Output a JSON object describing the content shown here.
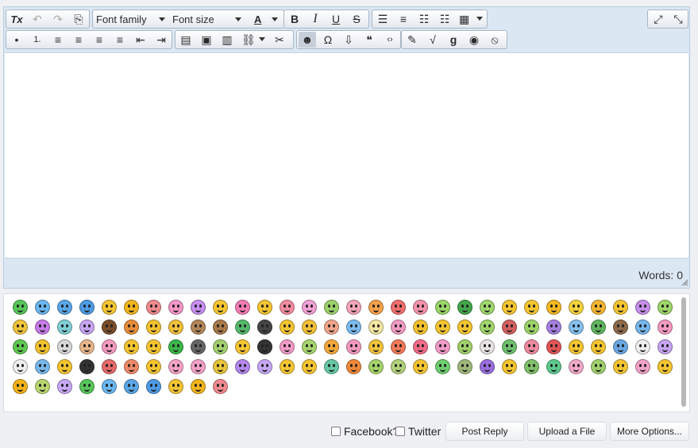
{
  "toolbar": {
    "row1": [
      {
        "name": "clear-formatting-icon",
        "glyph": "Tx",
        "disabled": false
      },
      {
        "name": "undo-icon",
        "glyph": "↶",
        "disabled": true
      },
      {
        "name": "redo-icon",
        "glyph": "↷",
        "disabled": true
      },
      {
        "name": "paste-icon",
        "glyph": "⎘",
        "disabled": false
      }
    ],
    "font_family": "Font family",
    "font_size": "Font size",
    "text_color_label": "A",
    "format": [
      {
        "name": "bold-icon",
        "glyph": "B"
      },
      {
        "name": "italic-icon",
        "glyph": "I"
      },
      {
        "name": "underline-icon",
        "glyph": "U"
      },
      {
        "name": "strikethrough-icon",
        "glyph": "S"
      }
    ],
    "insert": [
      {
        "name": "template-icon",
        "glyph": "☰"
      },
      {
        "name": "paragraph-block-icon",
        "glyph": "≡"
      },
      {
        "name": "columns-icon",
        "glyph": "☷"
      },
      {
        "name": "page-icon",
        "glyph": "☷"
      },
      {
        "name": "table-icon",
        "glyph": "▦"
      }
    ],
    "right": [
      {
        "name": "restore-icon",
        "glyph": "⤢"
      },
      {
        "name": "fullscreen-icon",
        "glyph": "⤡"
      }
    ],
    "row2_lists": [
      {
        "name": "bullet-list-icon",
        "glyph": "•"
      },
      {
        "name": "numbered-list-icon",
        "glyph": "1."
      },
      {
        "name": "align-left-icon",
        "glyph": "≡"
      },
      {
        "name": "align-center-icon",
        "glyph": "≡"
      },
      {
        "name": "align-right-icon",
        "glyph": "≡"
      },
      {
        "name": "justify-icon",
        "glyph": "≡"
      },
      {
        "name": "outdent-icon",
        "glyph": "⇤"
      },
      {
        "name": "indent-icon",
        "glyph": "⇥"
      }
    ],
    "row2_media": [
      {
        "name": "gallery-icon",
        "glyph": "▤"
      },
      {
        "name": "image-icon",
        "glyph": "▣"
      },
      {
        "name": "video-icon",
        "glyph": "▥"
      },
      {
        "name": "link-icon",
        "glyph": "⛓"
      },
      {
        "name": "unlink-icon",
        "glyph": "✂"
      }
    ],
    "row2_insert": [
      {
        "name": "emoticon-icon",
        "glyph": "☻",
        "active": true
      },
      {
        "name": "special-char-icon",
        "glyph": "Ω"
      },
      {
        "name": "upload-icon",
        "glyph": "⇩"
      },
      {
        "name": "quote-icon",
        "glyph": "❝"
      },
      {
        "name": "source-code-icon",
        "glyph": "‹›"
      }
    ],
    "row2_tools": [
      {
        "name": "highlighter-icon",
        "glyph": "✎"
      },
      {
        "name": "math-icon",
        "glyph": "√"
      },
      {
        "name": "google-icon",
        "glyph": "g"
      },
      {
        "name": "spoiler-icon",
        "glyph": "◉"
      },
      {
        "name": "hidden-icon",
        "glyph": "⦸"
      }
    ]
  },
  "status": {
    "word_count": "Words: 0"
  },
  "smileys": {
    "count": 130,
    "colors": [
      "#56c65a",
      "#6ab7f0",
      "#5aa7e8",
      "#4e9be6",
      "#f5c531",
      "#f2b51e",
      "#f18a8e",
      "#f597c8",
      "#c78ef0",
      "#f5c531",
      "#f47bb4",
      "#f5c531",
      "#f68ba0",
      "#f2a0d6",
      "#9cd16b",
      "#f4a5b8",
      "#f6a24b",
      "#f46e6e",
      "#f492a9",
      "#9ad568",
      "#43a54a",
      "#9ed76c",
      "#f5c531",
      "#f5c531",
      "#f5b820",
      "#f4d23b",
      "#f6b530",
      "#f5c531",
      "#c58ee9",
      "#9ed66a",
      "#f0c43a",
      "#c67be8",
      "#7fcfd6",
      "#c8a4f4",
      "#7a4d2a",
      "#e78c3a",
      "#f4c22e",
      "#f2c13a",
      "#b38657",
      "#a8794a",
      "#55b96b",
      "#444444",
      "#f5c531",
      "#f1c038",
      "#f2a58a",
      "#7bbbef",
      "#f5e6a0",
      "#f29ac4",
      "#f4c22e",
      "#f5c531",
      "#f5c531",
      "#9fd46a",
      "#d45f5f",
      "#9dd46a",
      "#a57fe0",
      "#84c1ef",
      "#5fb55f",
      "#8e6a4a",
      "#76b6ec",
      "#f69ac2",
      "#5ec84f",
      "#f1c12c",
      "#d8d8d8",
      "#e8b48a",
      "#f599c0",
      "#f5c531",
      "#f5c531",
      "#3bb64a",
      "#666666",
      "#a3d06f",
      "#f5c531",
      "#333333",
      "#f29ac8",
      "#a6d56f",
      "#f6a83b",
      "#f599c0",
      "#f2c33b",
      "#f57a5a",
      "#f36a88",
      "#f29ac8",
      "#a1d06a",
      "#e9e3e3",
      "#6dbf6d",
      "#f08aa0",
      "#e25555",
      "#f5c531",
      "#f5c531",
      "#6aa7e3",
      "#eeeeee",
      "#c7a4f2",
      "#eeeeee",
      "#77b9ee",
      "#f5c531",
      "#333333",
      "#e86a6a",
      "#f18a6a",
      "#f5c531",
      "#f7a2c6",
      "#f3a1c8",
      "#e8c53a",
      "#b487f0",
      "#c6a7f4",
      "#f5c531",
      "#f5c531",
      "#66c9a4",
      "#f0893a",
      "#a5d46a",
      "#b3d27a",
      "#f5c531",
      "#6fcf6f",
      "#9fb87a",
      "#9a6ee0",
      "#f5c531",
      "#7fc06a",
      "#5ecb8e",
      "#f3a8c8",
      "#a0d06c",
      "#f5c531",
      "#f3a3c8",
      "#f5c531",
      "#f5b21a",
      "#b9d66f",
      "#c8a7f6"
    ]
  },
  "bottom": {
    "facebook_label": "Facebook?",
    "twitter_label": "Twitter",
    "post_reply": "Post Reply",
    "upload_file": "Upload a File",
    "more_options": "More Options..."
  }
}
